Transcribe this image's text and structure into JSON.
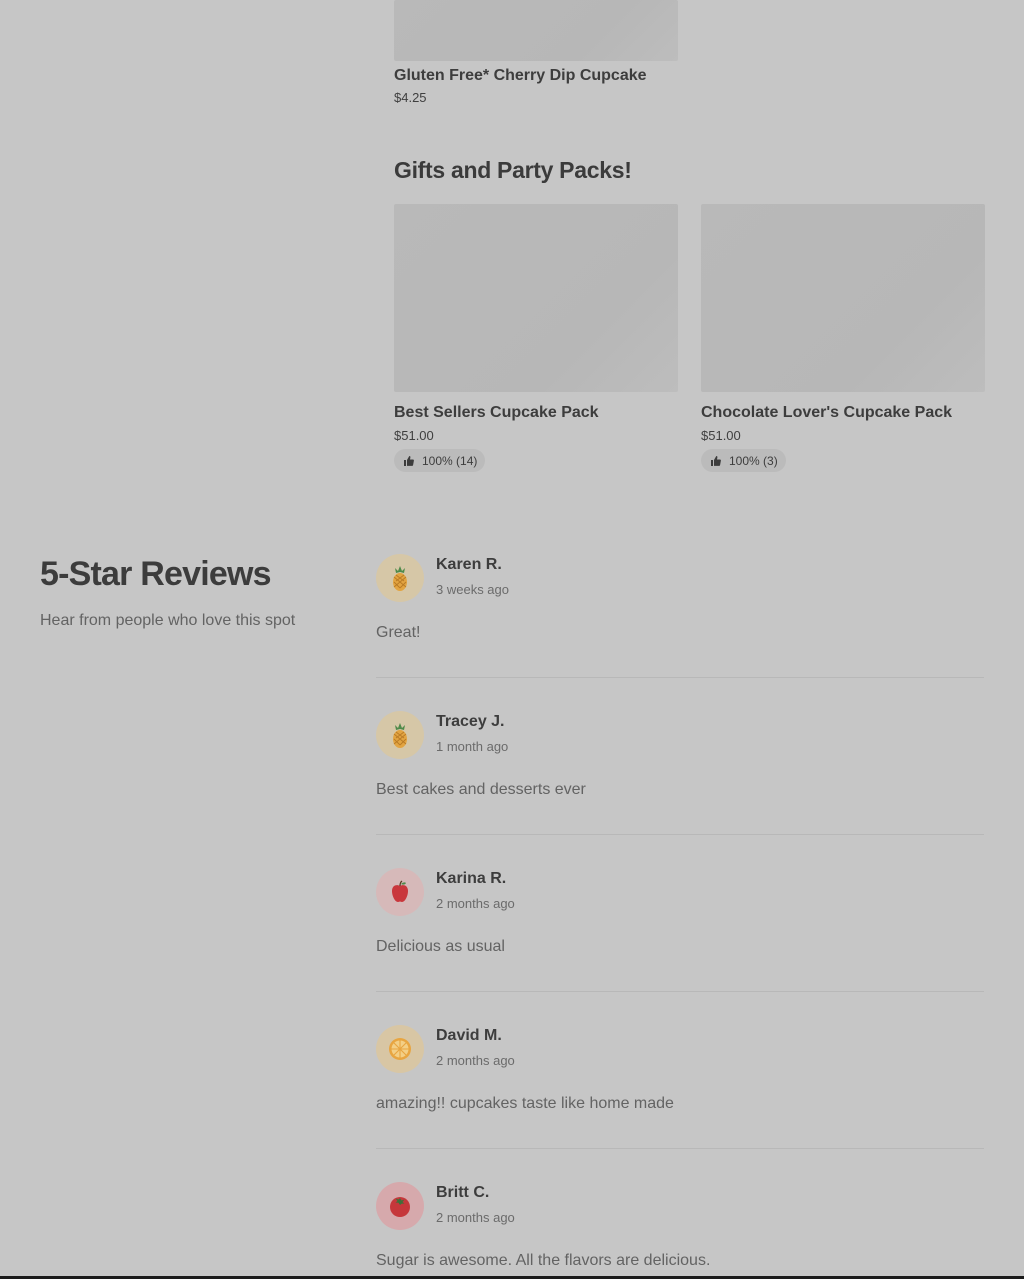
{
  "top_product": {
    "title": "Gluten Free* Cherry Dip Cupcake",
    "price": "$4.25"
  },
  "gifts_section": {
    "title": "Gifts and Party Packs!",
    "items": [
      {
        "title": "Best Sellers Cupcake Pack",
        "price": "$51.00",
        "rating": "100% (14)",
        "rating_icon": "thumbs-up-icon"
      },
      {
        "title": "Chocolate Lover's Cupcake Pack",
        "price": "$51.00",
        "rating": "100% (3)",
        "rating_icon": "thumbs-up-icon"
      }
    ]
  },
  "reviews": {
    "title": "5-Star Reviews",
    "subtitle": "Hear from people who love this spot",
    "items": [
      {
        "name": "Karen R.",
        "time": "3 weeks ago",
        "text": "Great!",
        "avatar": "pineapple-icon",
        "avatar_bg": "#d6c7a7"
      },
      {
        "name": "Tracey J.",
        "time": "1 month ago",
        "text": "Best cakes and desserts ever",
        "avatar": "pineapple-icon",
        "avatar_bg": "#d6c7a7"
      },
      {
        "name": "Karina R.",
        "time": "2 months ago",
        "text": "Delicious as usual",
        "avatar": "apple-icon",
        "avatar_bg": "#d6b9b9"
      },
      {
        "name": "David M.",
        "time": "2 months ago",
        "text": "amazing!! cupcakes taste like home made",
        "avatar": "orange-slice-icon",
        "avatar_bg": "#d8c6a4"
      },
      {
        "name": "Britt C.",
        "time": "2 months ago",
        "text": "Sugar is awesome. All the flavors are delicious.",
        "avatar": "tomato-icon",
        "avatar_bg": "#d6a9ac"
      }
    ]
  },
  "colors": {
    "background": "#c6c6c6",
    "image_placeholder": "#b9b9b9",
    "badge_bg": "#bbbbbb",
    "divider": "#b8b8b8"
  }
}
